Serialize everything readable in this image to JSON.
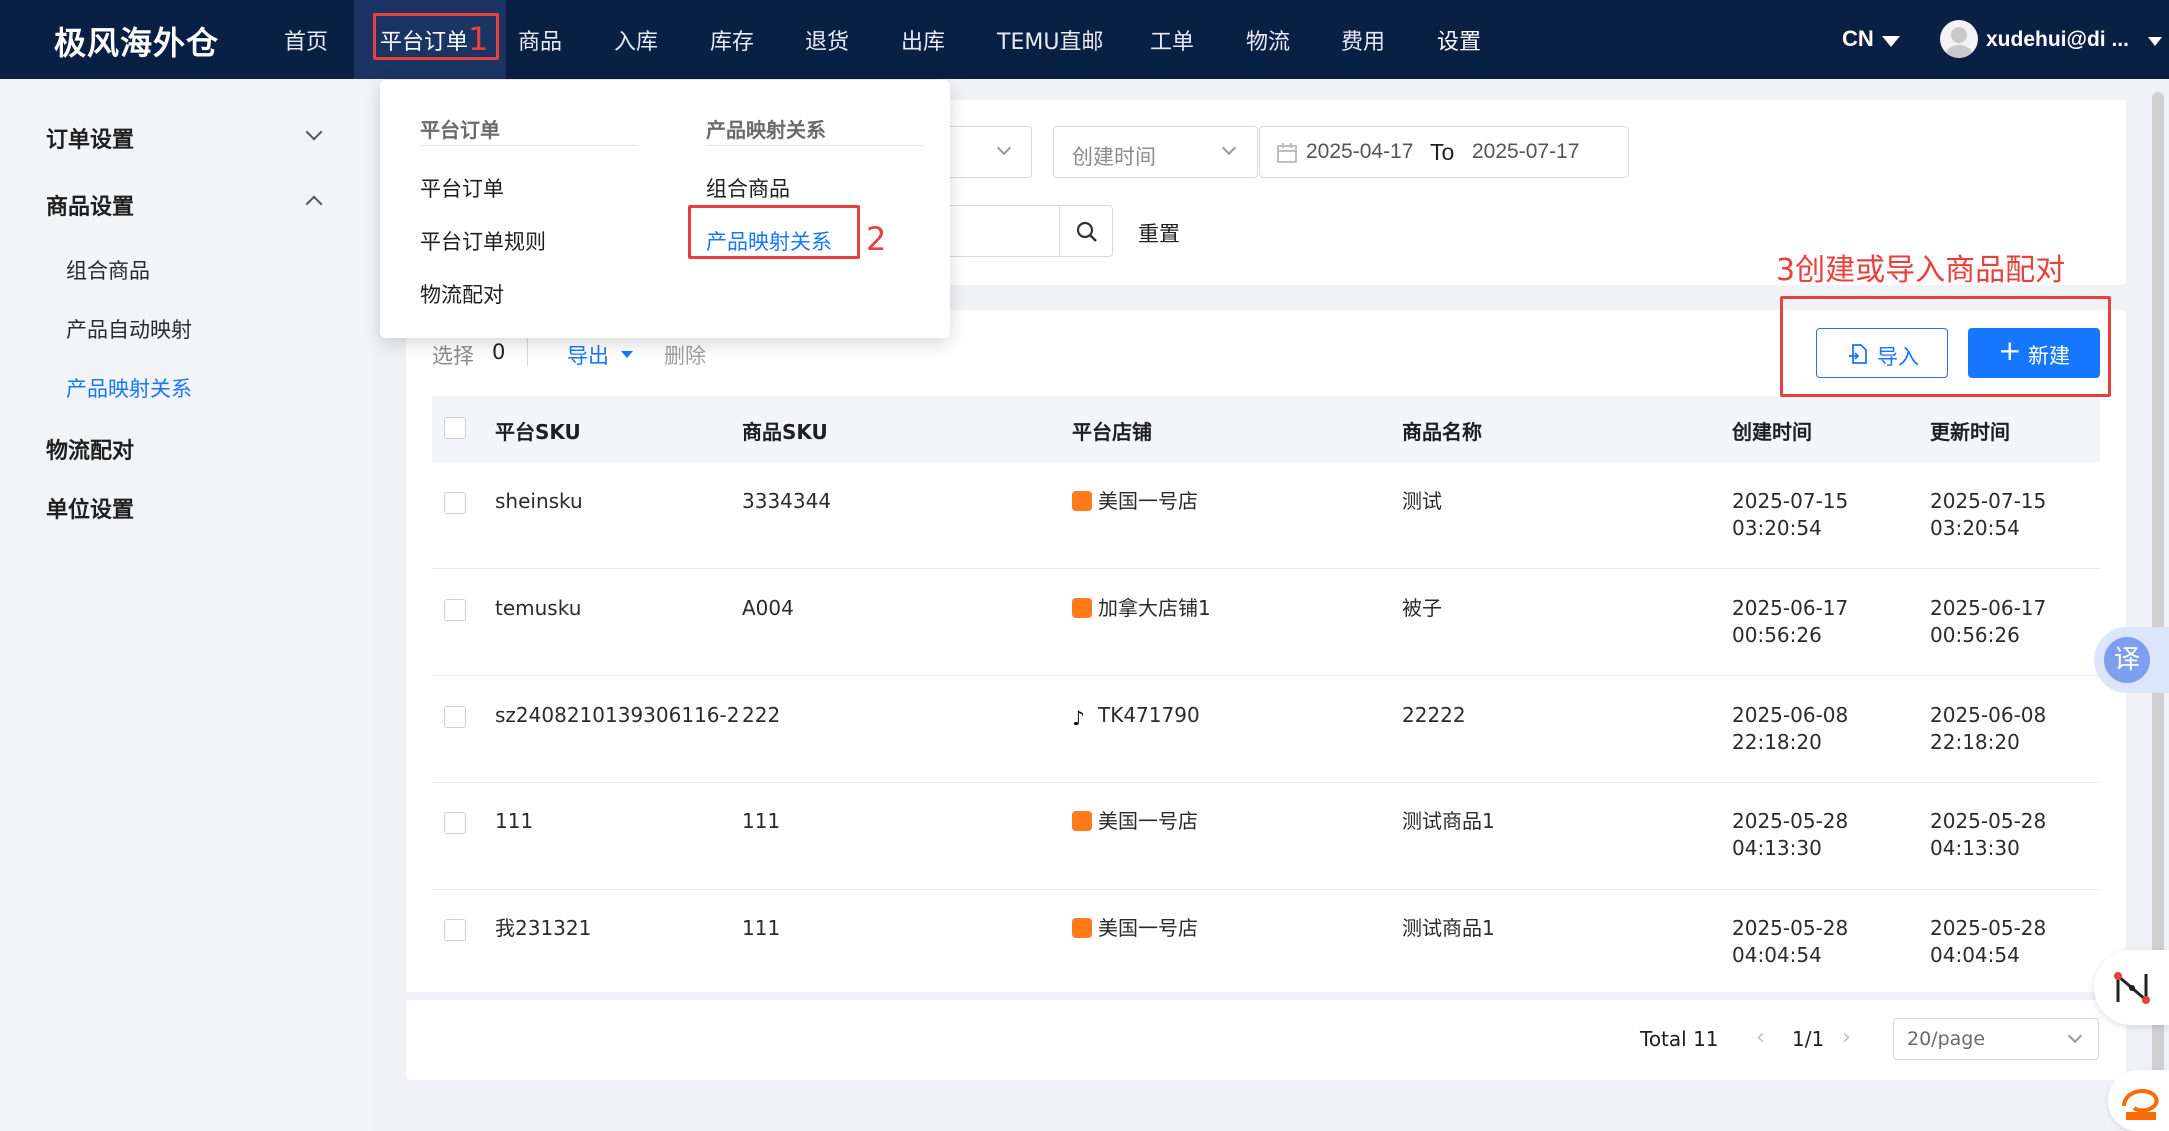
{
  "brand": "极风海外仓",
  "nav": [
    {
      "label": "首页"
    },
    {
      "label": "平台订单"
    },
    {
      "label": "商品"
    },
    {
      "label": "入库"
    },
    {
      "label": "库存"
    },
    {
      "label": "退货"
    },
    {
      "label": "出库"
    },
    {
      "label": "TEMU直邮"
    },
    {
      "label": "工单"
    },
    {
      "label": "物流"
    },
    {
      "label": "费用"
    },
    {
      "label": "设置"
    }
  ],
  "lang": "CN",
  "user": "xudehui@di ...",
  "sidebar": {
    "groups": [
      {
        "label": "订单设置"
      },
      {
        "label": "商品设置"
      },
      {
        "label": "物流配对"
      },
      {
        "label": "单位设置"
      }
    ],
    "sub_items": [
      {
        "label": "组合商品"
      },
      {
        "label": "产品自动映射"
      },
      {
        "label": "产品映射关系"
      }
    ]
  },
  "dropdown": {
    "col1_title": "平台订单",
    "col1_items": [
      "平台订单",
      "平台订单规则",
      "物流配对"
    ],
    "col2_title": "产品映射关系",
    "col2_items": [
      "组合商品",
      "产品映射关系"
    ]
  },
  "filters": {
    "time_type": "创建时间",
    "date_from": "2025-04-17",
    "date_sep": "To",
    "date_to": "2025-07-17",
    "reset": "重置"
  },
  "toolbar": {
    "select_label": "选择",
    "select_count": "0",
    "export": "导出",
    "delete": "删除",
    "import": "导入",
    "new": "新建"
  },
  "table": {
    "headers": [
      "平台SKU",
      "商品SKU",
      "平台店铺",
      "商品名称",
      "创建时间",
      "更新时间"
    ],
    "rows": [
      {
        "platform_sku": "sheinsku",
        "product_sku": "3334344",
        "shop": "美国一号店",
        "shop_icon": "shop-icon",
        "name": "测试",
        "created_date": "2025-07-15",
        "created_time": "03:20:54",
        "updated_date": "2025-07-15",
        "updated_time": "03:20:54"
      },
      {
        "platform_sku": "temusku",
        "product_sku": "A004",
        "shop": "加拿大店铺1",
        "shop_icon": "shop-icon",
        "name": "被子",
        "created_date": "2025-06-17",
        "created_time": "00:56:26",
        "updated_date": "2025-06-17",
        "updated_time": "00:56:26"
      },
      {
        "platform_sku": "sz2408210139306116-2",
        "product_sku": "222",
        "shop": "TK471790",
        "shop_icon": "tiktok-icon",
        "name": "22222",
        "created_date": "2025-06-08",
        "created_time": "22:18:20",
        "updated_date": "2025-06-08",
        "updated_time": "22:18:20"
      },
      {
        "platform_sku": "111",
        "product_sku": "111",
        "shop": "美国一号店",
        "shop_icon": "shop-icon",
        "name": "测试商品1",
        "created_date": "2025-05-28",
        "created_time": "04:13:30",
        "updated_date": "2025-05-28",
        "updated_time": "04:13:30"
      },
      {
        "platform_sku": "我231321",
        "product_sku": "111",
        "shop": "美国一号店",
        "shop_icon": "shop-icon",
        "name": "测试商品1",
        "created_date": "2025-05-28",
        "created_time": "04:04:54",
        "updated_date": "2025-05-28",
        "updated_time": "04:04:54"
      }
    ]
  },
  "pagination": {
    "total": "Total 11",
    "page": "1/1",
    "page_size": "20/page"
  },
  "annotations": {
    "a1": "1",
    "a2": "2",
    "a3": "3创建或导入商品配对"
  },
  "widgets": {
    "translate": "译"
  },
  "colors": {
    "topbar": "#0a1f44",
    "primary": "#1677ff",
    "annotation": "#e8403d"
  }
}
